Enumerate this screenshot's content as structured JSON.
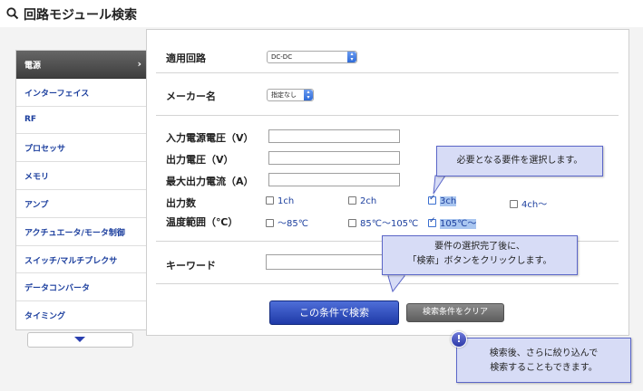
{
  "page": {
    "title": "回路モジュール検索"
  },
  "sidebar": {
    "items": [
      {
        "label": "電源",
        "active": true
      },
      {
        "label": "インターフェイス"
      },
      {
        "label": "RF"
      },
      {
        "label": "プロセッサ"
      },
      {
        "label": "メモリ"
      },
      {
        "label": "アンプ"
      },
      {
        "label": "アクチュエータ/モータ制御"
      },
      {
        "label": "スイッチ/マルチプレクサ"
      },
      {
        "label": "データコンバータ"
      },
      {
        "label": "タイミング"
      }
    ],
    "active_chevron": "›"
  },
  "form": {
    "circuit": {
      "label": "適用回路",
      "value": "DC-DC"
    },
    "maker": {
      "label": "メーカー名",
      "value": "指定なし"
    },
    "input_voltage": {
      "label": "入力電源電圧（V）",
      "value": ""
    },
    "output_voltage": {
      "label": "出力電圧（V）",
      "value": ""
    },
    "max_current": {
      "label": "最大出力電流（A）",
      "value": ""
    },
    "outputs": {
      "label": "出力数",
      "options": [
        {
          "label": "1ch",
          "checked": false
        },
        {
          "label": "2ch",
          "checked": false
        },
        {
          "label": "3ch",
          "checked": true
        },
        {
          "label": "4ch〜",
          "checked": false
        }
      ]
    },
    "temp_range": {
      "label": "温度範囲（℃）",
      "options": [
        {
          "label": "〜85℃",
          "checked": false
        },
        {
          "label": "85℃〜105℃",
          "checked": false
        },
        {
          "label": "105℃〜",
          "checked": true
        }
      ]
    },
    "keyword": {
      "label": "キーワード",
      "value": ""
    },
    "search_button": "この条件で検索",
    "clear_button": "検索条件をクリア"
  },
  "callouts": {
    "select_tip": "必要となる要件を選択します。",
    "search_tip_line1": "要件の選択完了後に、",
    "search_tip_line2": "「検索」ボタンをクリックします。",
    "narrow_tip_line1": "検索後、さらに絞り込んで",
    "narrow_tip_line2": "検索することもできます。",
    "info_badge": "!"
  },
  "colors": {
    "accent": "#1c3f9e",
    "button_primary": "#2a46b8",
    "callout_bg": "#d7dcf6"
  }
}
